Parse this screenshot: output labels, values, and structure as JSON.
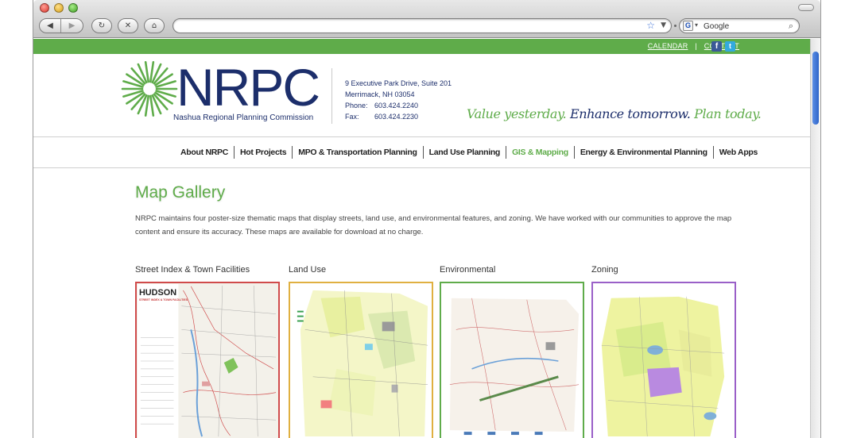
{
  "browser": {
    "search_placeholder": "Google"
  },
  "utility": {
    "links": [
      "CALENDAR",
      "CONTACT"
    ],
    "facebook_letter": "f",
    "twitter_letter": "t"
  },
  "header": {
    "logo_text": "NRPC",
    "logo_subtitle": "Nashua Regional Planning Commission",
    "address_line1": "9 Executive Park Drive, Suite 201",
    "address_line2": "Merrimack, NH 03054",
    "phone_label": "Phone:",
    "phone": "603.424.2240",
    "fax_label": "Fax:",
    "fax": "603.424.2230",
    "tagline_part1": "Value yesterday.",
    "tagline_part2": "Enhance tomorrow.",
    "tagline_part3": "Plan today."
  },
  "nav": {
    "items": [
      {
        "label": "About NRPC",
        "active": false
      },
      {
        "label": "Hot Projects",
        "active": false
      },
      {
        "label": "MPO & Transportation Planning",
        "active": false
      },
      {
        "label": "Land Use Planning",
        "active": false
      },
      {
        "label": "GIS & Mapping",
        "active": true
      },
      {
        "label": "Energy & Environmental Planning",
        "active": false
      },
      {
        "label": "Web Apps",
        "active": false
      }
    ]
  },
  "main": {
    "title": "Map Gallery",
    "intro": "NRPC maintains four poster-size thematic maps that display streets, land use, and environmental features, and zoning. We have worked with our communities to approve the map content and ensure its accuracy. These maps are available for download at no charge."
  },
  "gallery": {
    "maps": [
      {
        "caption": "Street Index & Town Facilities",
        "border_color": "#d04a4a",
        "map_title": "HUDSON",
        "map_subtitle": "STREET INDEX & TOWN FACILITIES"
      },
      {
        "caption": "Land Use",
        "border_color": "#e0b040",
        "map_title": "",
        "map_subtitle": ""
      },
      {
        "caption": "Environmental",
        "border_color": "#5fac4a",
        "map_title": "",
        "map_subtitle": ""
      },
      {
        "caption": "Zoning",
        "border_color": "#9a5fc8",
        "map_title": "",
        "map_subtitle": ""
      }
    ]
  },
  "colors": {
    "brand_green": "#5fac4a",
    "brand_navy": "#1c2e6b"
  }
}
